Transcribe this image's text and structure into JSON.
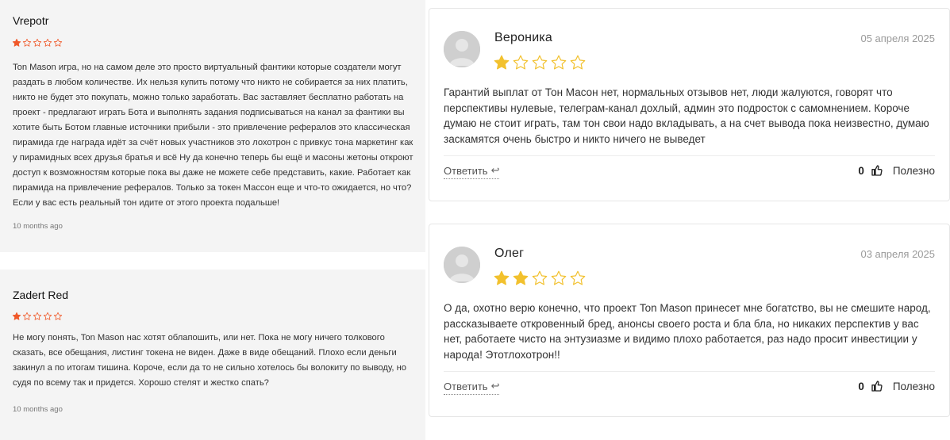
{
  "left_reviews": [
    {
      "author": "Vrepotr",
      "rating": 1,
      "max_rating": 5,
      "text": "Ton Mason игра, но на самом деле это просто виртуальный фантики которые создатели могут раздать в любом количестве. Их нельзя купить потому что никто не собирается за них платить, никто не будет это покупать, можно только заработать. Вас заставляет бесплатно работать на проект - предлагают играть Бота и выполнять задания подписываться на канал за фантики вы хотите быть Ботом главные источники прибыли - это привлечение рефералов это классическая пирамида где награда идёт за счёт новых участников это лохотрон с привкус тона маркетинг как у пирамидных всех друзья братья и всё Ну да конечно теперь бы ещё и масоны жетоны откроют доступ к возможностям которые пока вы даже не можете себе представить, какие. Работает как пирамида на привлечение рефералов. Только за токен Массон еще и что-то ожидается, но что? Если у вас есть реальный тон идите от этого проекта подальше!",
      "time": "10 months ago"
    },
    {
      "author": "Zadert Red",
      "rating": 1,
      "max_rating": 5,
      "text": "Не могу понять, Ton Mason нас хотят облапошить, или нет. Пока не могу ничего толкового сказать, все обещания, листинг токена не виден. Даже в виде обещаний. Плохо если деньги закинул а по итогам тишина. Короче, если да то не сильно хотелось бы волокиту по выводу, но судя по всему так и придется. Хорошо стелят и жестко спать?",
      "time": "10 months ago"
    }
  ],
  "right_reviews": [
    {
      "author": "Вероника",
      "date": "05 апреля 2025",
      "rating": 1,
      "max_rating": 5,
      "text": "Гарантий выплат от Тон Масон нет, нормальных отзывов нет, люди жалуются, говорят что перспективы нулевые, телеграм-канал дохлый, админ это подросток с самомнением. Короче думаю не стоит играть, там тон свои надо вкладывать, а на счет вывода пока неизвестно, думаю заскамятся очень быстро и никто ничего не выведет",
      "reply_label": "Ответить",
      "helpful_count": "0",
      "helpful_label": "Полезно"
    },
    {
      "author": "Олег",
      "date": "03 апреля 2025",
      "rating": 2,
      "max_rating": 5,
      "text": "О да, охотно верю конечно, что проект Ton Mason принесет мне богатство, вы не смешите народ, рассказываете откровенный бред, анонсы своего роста и бла бла, но никаких перспектив у вас нет, работаете чисто на энтузиазме и видимо плохо работается, раз надо просит инвестиции у народа! Этотлохотрон!!",
      "reply_label": "Ответить",
      "helpful_count": "0",
      "helpful_label": "Полезно"
    }
  ],
  "colors": {
    "left_star": "#f0592a",
    "right_star": "#f2c12e",
    "card_bg_left": "#f4f4f4"
  },
  "icons": {
    "reply": "reply-arrow-icon",
    "helpful": "thumbs-up-icon",
    "avatar": "default-avatar-icon",
    "star": "star-icon"
  }
}
